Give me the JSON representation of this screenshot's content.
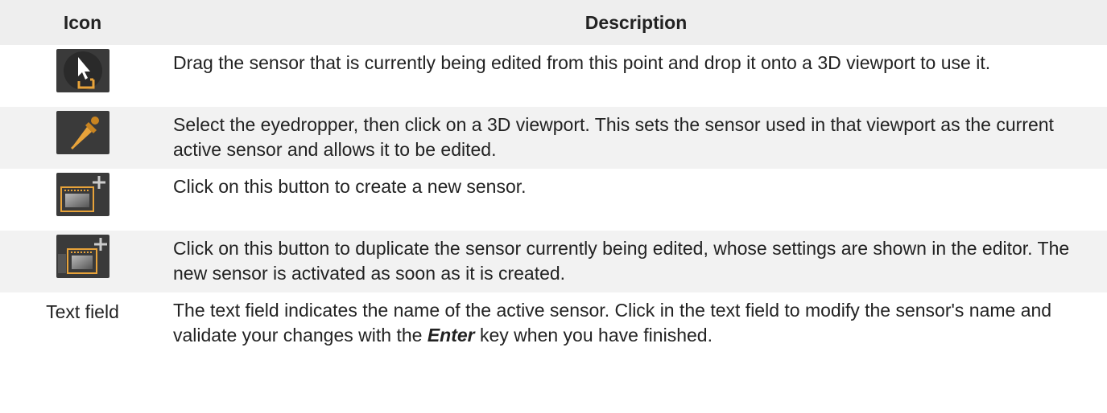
{
  "table": {
    "headers": {
      "icon": "Icon",
      "description": "Description"
    },
    "rows": [
      {
        "icon_name": "drag-sensor-icon",
        "description": "Drag the sensor that is currently being edited from this point and drop it onto a 3D viewport to use it."
      },
      {
        "icon_name": "eyedropper-icon",
        "description": "Select the eyedropper, then click on a 3D viewport. This sets the sensor used in that viewport as the current active sensor and allows it to be edited."
      },
      {
        "icon_name": "new-sensor-icon",
        "description": "Click on this button to create a new sensor."
      },
      {
        "icon_name": "duplicate-sensor-icon",
        "description": "Click on this button to duplicate the sensor currently being edited, whose settings are shown in the editor. The new sensor is activated as soon as it is created."
      },
      {
        "icon_label": "Text field",
        "description_before": "The text field indicates the name of the active sensor. Click in the text field to modify the sensor's name and validate your changes with the ",
        "description_key": "Enter",
        "description_after": " key when you have finished."
      }
    ]
  },
  "colors": {
    "accent": "#e8a33a",
    "header_bg": "#eeeeee",
    "stripe_bg": "#f2f2f2",
    "icon_bg": "#3a3a3a"
  }
}
